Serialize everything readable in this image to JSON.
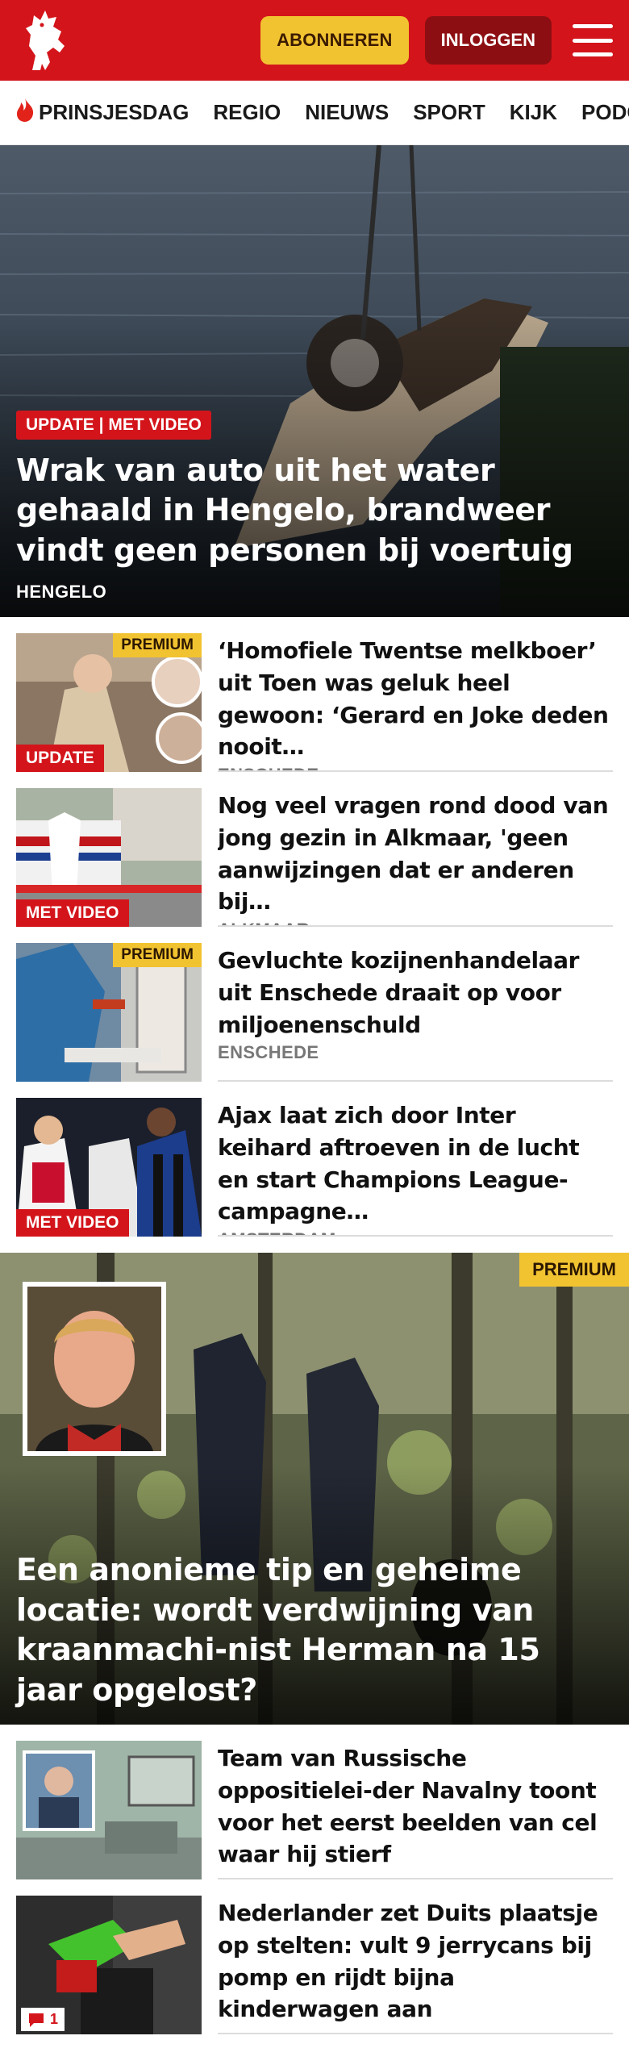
{
  "header": {
    "subscribe_label": "ABONNEREN",
    "login_label": "INLOGGEN"
  },
  "nav": {
    "items": [
      "PRINSJESDAG",
      "REGIO",
      "NIEUWS",
      "SPORT",
      "KIJK",
      "PODCAST"
    ]
  },
  "hero": {
    "label": "UPDATE | MET VIDEO",
    "title": "Wrak van auto uit het water gehaald in Hengelo, brandweer vindt geen personen bij voertuig",
    "location": "HENGELO"
  },
  "articles": [
    {
      "title": "‘Homofiele Twentse melkboer’ uit Toen was geluk heel gewoon: ‘Gerard en Joke deden nooit…",
      "location": "ENSCHEDE",
      "premium": "PREMIUM",
      "label": "UPDATE"
    },
    {
      "title": "Nog veel vragen rond dood van jong gezin in Alkmaar, 'geen aanwijzingen dat er anderen bij…",
      "location": "ALKMAAR",
      "label": "MET VIDEO"
    },
    {
      "title": "Gevluchte kozijnenhandelaar uit Enschede draait op voor miljoenenschuld",
      "location": "ENSCHEDE",
      "premium": "PREMIUM"
    },
    {
      "title": "Ajax laat zich door Inter keihard aftroeven in de lucht en start Champions League-campagne…",
      "location": "AMSTERDAM",
      "label": "MET VIDEO"
    }
  ],
  "feature": {
    "premium": "PREMIUM",
    "title": "Een anonieme tip en geheime locatie: wordt verdwijning van kraanmachi-nist Herman na 15 jaar opgelost?"
  },
  "articles2": [
    {
      "title": "Team van Russische oppositielei-der Navalny toont voor het eerst beelden van cel waar hij stierf"
    },
    {
      "title": "Nederlander zet Duits plaatsje op stelten: vult 9 jerrycans bij pomp en rijdt bijna kinderwagen aan",
      "comments": "1"
    }
  ],
  "colors": {
    "brand_red": "#d3151b",
    "premium_yellow": "#f2c331",
    "login_dark_red": "#8d0e12"
  },
  "icons": [
    "twente-horse-logo-icon",
    "menu-icon",
    "flame-icon",
    "comment-icon"
  ]
}
